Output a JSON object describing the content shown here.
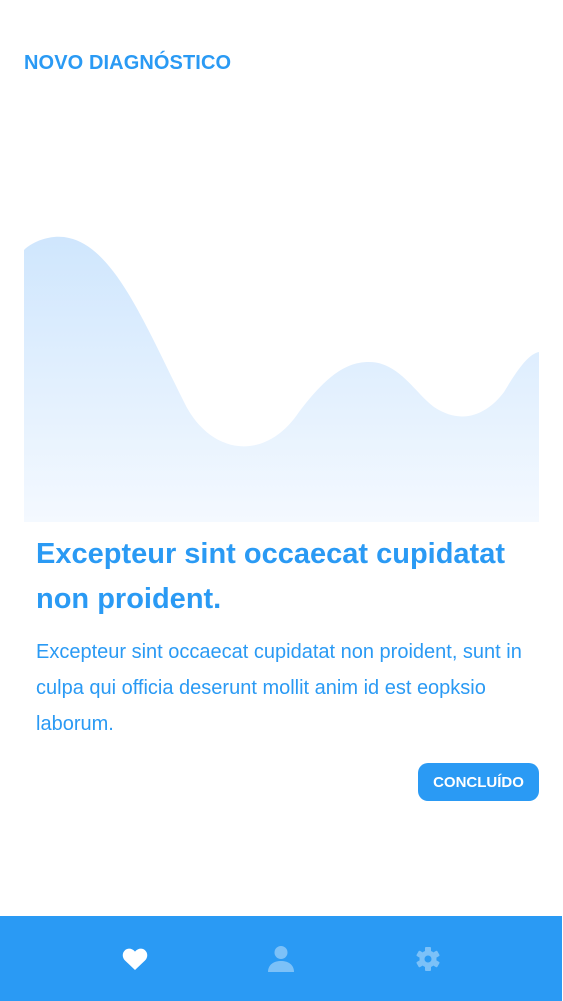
{
  "header": {
    "title": "NOVO DIAGNÓSTICO"
  },
  "content": {
    "heading": "Excepteur sint occaecat cupidatat non proident.",
    "body": "Excepteur sint occaecat cupidatat non proident, sunt in culpa qui officia deserunt mollit anim id est eopksio laborum.",
    "done_label": "CONCLUÍDO"
  },
  "bottom_nav": {
    "items": [
      {
        "icon": "heart-icon",
        "active": true
      },
      {
        "icon": "person-icon",
        "active": false
      },
      {
        "icon": "gear-icon",
        "active": false
      }
    ]
  },
  "colors": {
    "accent": "#2a9af4",
    "wave_top": "#cfe6fd",
    "wave_bottom": "#f4f9ff",
    "nav_inactive_icon": "#7cc1f8"
  }
}
